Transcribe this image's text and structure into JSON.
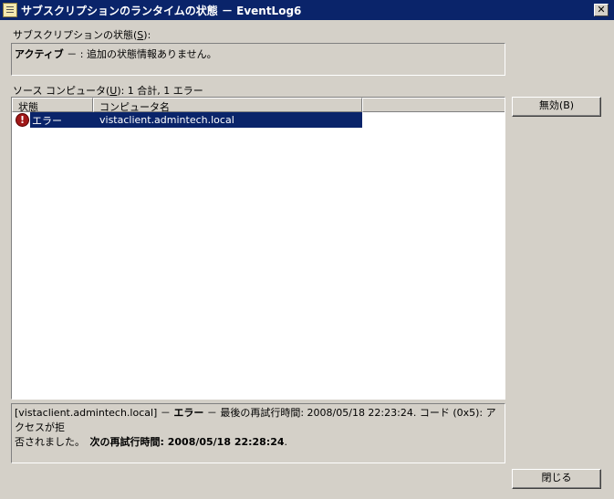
{
  "window": {
    "title": "サブスクリプションのランタイムの状態 － EventLog6",
    "close_label": "✕"
  },
  "subscription_status": {
    "label": "サブスクリプションの状態(",
    "mnemonic": "S",
    "label_suffix": "):",
    "state": "アクティブ",
    "separator": " － : ",
    "message": "追加の状態情報ありません。"
  },
  "source_computers": {
    "label": "ソース コンピュータ(",
    "mnemonic": "U",
    "label_suffix": "): 1 合計, 1 エラー",
    "columns": [
      "状態",
      "コンピュータ名"
    ],
    "rows": [
      {
        "status": "エラー",
        "computer": "vistaclient.admintech.local",
        "selected": true
      }
    ]
  },
  "detail": {
    "prefix": "[vistaclient.admintech.local] － ",
    "error_word": "エラー",
    "middle": " － 最後の再試行時間: 2008/05/18 22:23:24. コード (0x5): アクセスが拒",
    "line2_start": "否されました。　",
    "next_retry_label": "次の再試行時間: 2008/05/18 22:28:24",
    "end": "."
  },
  "buttons": {
    "disable": "無効(B)",
    "close": "閉じる"
  }
}
